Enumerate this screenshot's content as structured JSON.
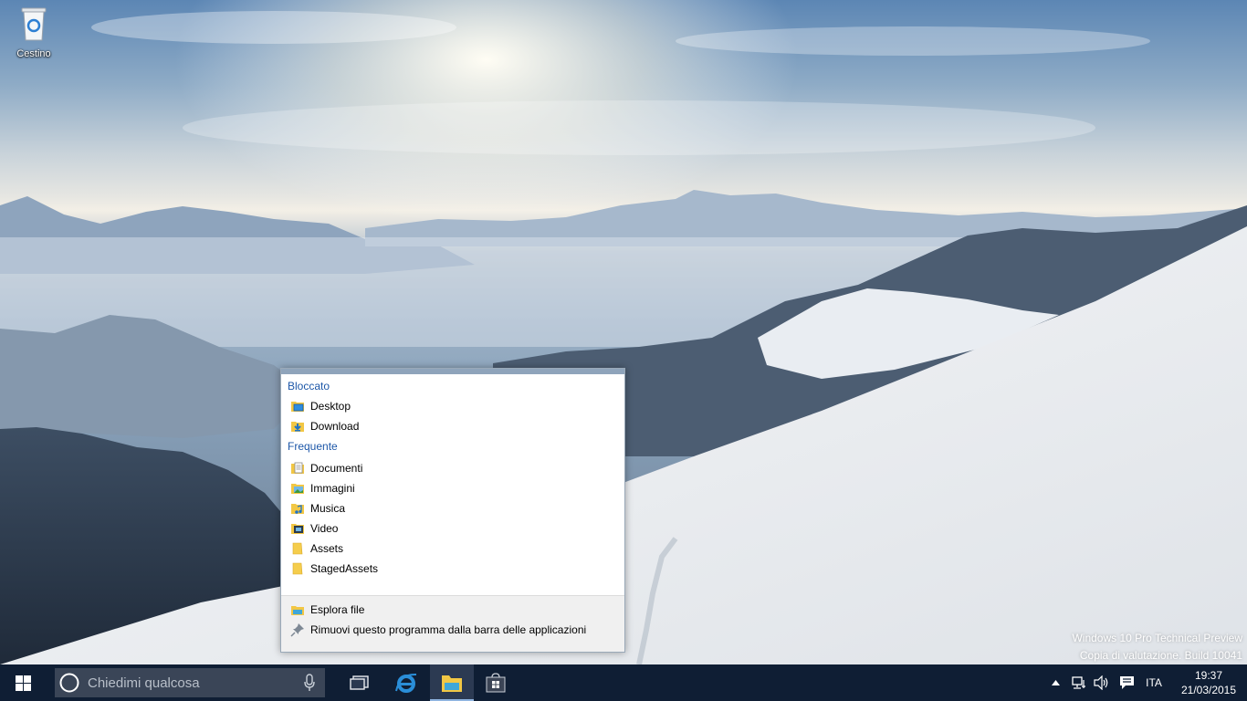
{
  "desktop": {
    "recycle_bin_label": "Cestino",
    "watermark_line1": "Windows 10 Pro Technical Preview",
    "watermark_line2": "Copia di valutazione. Build 10041"
  },
  "jumplist": {
    "pinned_title": "Bloccato",
    "pinned": [
      {
        "label": "Desktop",
        "icon": "desktop-folder-icon"
      },
      {
        "label": "Download",
        "icon": "download-folder-icon"
      }
    ],
    "frequent_title": "Frequente",
    "frequent": [
      {
        "label": "Documenti",
        "icon": "documents-folder-icon"
      },
      {
        "label": "Immagini",
        "icon": "pictures-folder-icon"
      },
      {
        "label": "Musica",
        "icon": "music-folder-icon"
      },
      {
        "label": "Video",
        "icon": "video-folder-icon"
      },
      {
        "label": "Assets",
        "icon": "folder-icon"
      },
      {
        "label": "StagedAssets",
        "icon": "folder-icon"
      }
    ],
    "tasks": [
      {
        "label": "Esplora file",
        "icon": "file-explorer-icon"
      },
      {
        "label": "Rimuovi questo programma dalla barra delle applicazioni",
        "icon": "unpin-icon"
      }
    ]
  },
  "taskbar": {
    "search_placeholder": "Chiedimi qualcosa",
    "language": "ITA",
    "time": "19:37",
    "date": "21/03/2015"
  },
  "colors": {
    "taskbar_bg": "#0f1e34",
    "jumplist_section": "#1d57a8",
    "accent": "#8fb4e0"
  }
}
